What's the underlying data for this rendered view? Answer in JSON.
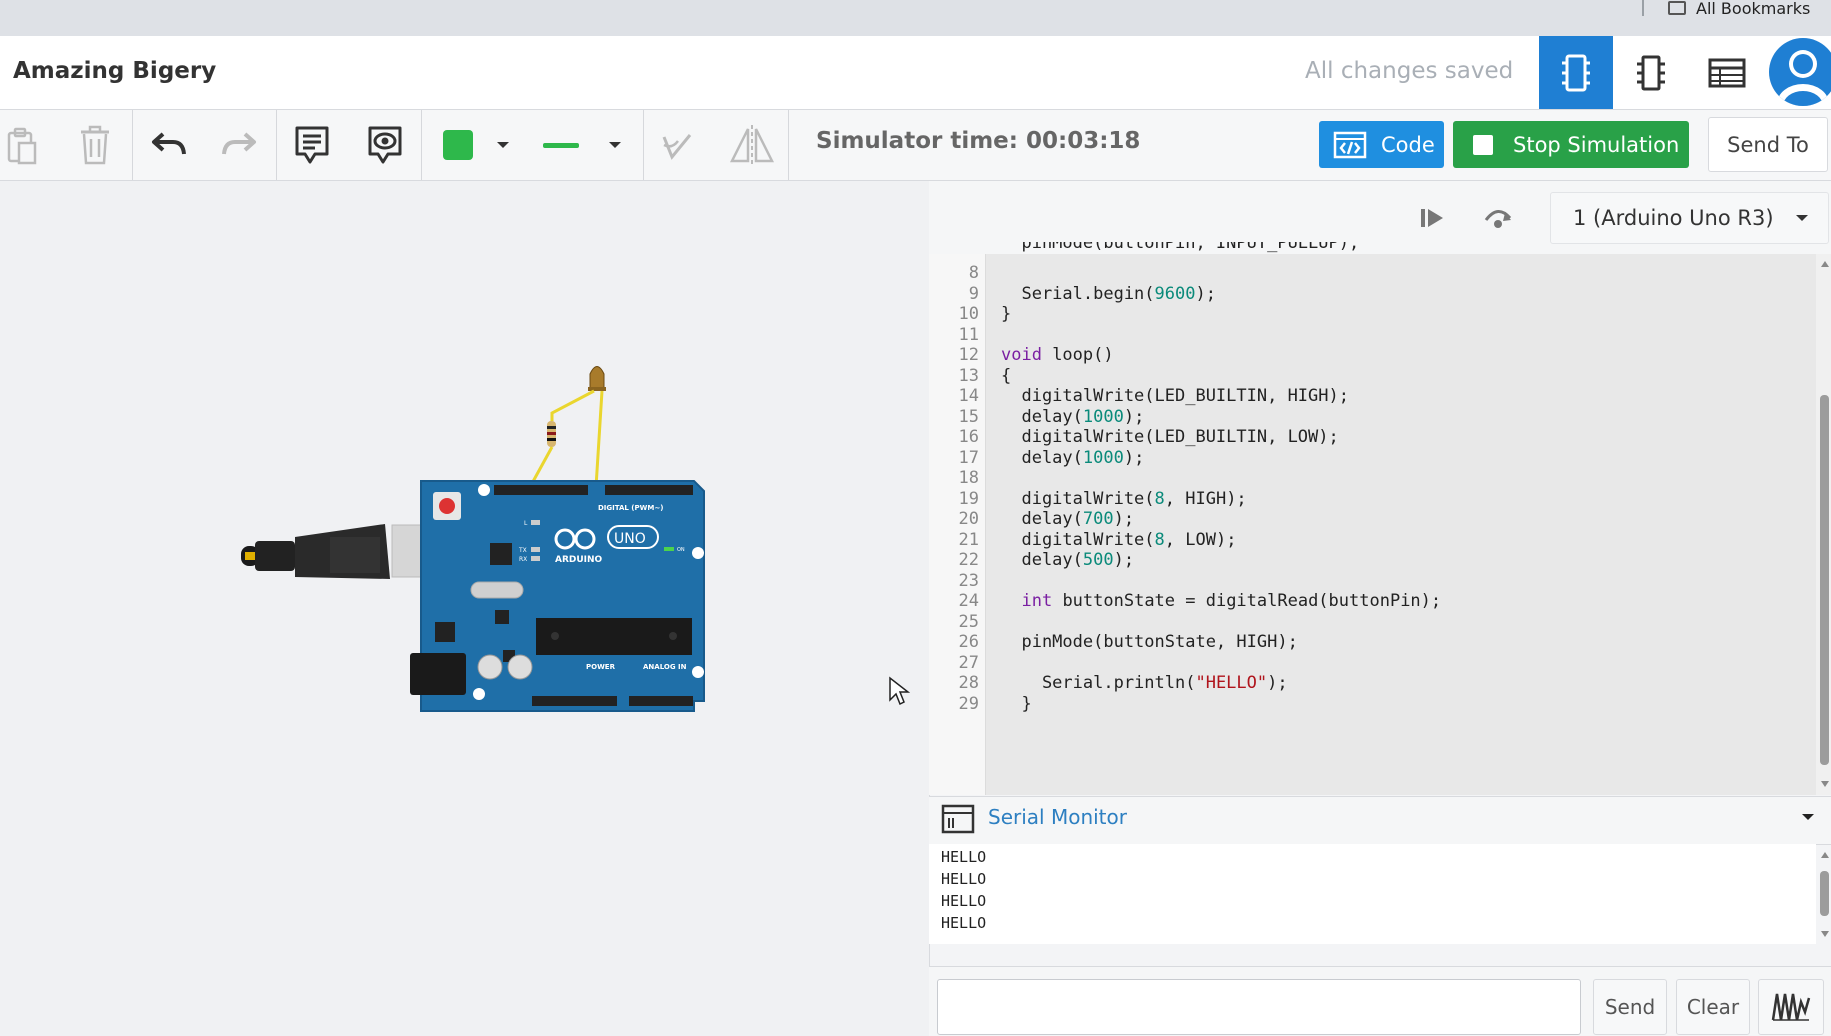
{
  "browser": {
    "bookmarks_label": "All Bookmarks"
  },
  "header": {
    "project_title": "Amazing Bigery",
    "save_status": "All changes saved"
  },
  "toolbar": {
    "simulator_time": "Simulator time: 00:03:18",
    "code_label": "Code",
    "stop_label": "Stop Simulation",
    "send_to_label": "Send To",
    "fill_color": "#2eb84b"
  },
  "code_panel": {
    "device": "1 (Arduino Uno R3)",
    "lines": [
      {
        "n": "8",
        "html": ""
      },
      {
        "n": "9",
        "html": "  Serial.begin(<span class=\"num\">9600</span>);"
      },
      {
        "n": "10",
        "html": "}"
      },
      {
        "n": "11",
        "html": ""
      },
      {
        "n": "12",
        "html": "<span class=\"kw\">void</span> loop()"
      },
      {
        "n": "13",
        "html": "{"
      },
      {
        "n": "14",
        "html": "  digitalWrite(LED_BUILTIN, HIGH);"
      },
      {
        "n": "15",
        "html": "  delay(<span class=\"num\">1000</span>);"
      },
      {
        "n": "16",
        "html": "  digitalWrite(LED_BUILTIN, LOW);"
      },
      {
        "n": "17",
        "html": "  delay(<span class=\"num\">1000</span>);"
      },
      {
        "n": "18",
        "html": ""
      },
      {
        "n": "19",
        "html": "  digitalWrite(<span class=\"num\">8</span>, HIGH);"
      },
      {
        "n": "20",
        "html": "  delay(<span class=\"num\">700</span>);"
      },
      {
        "n": "21",
        "html": "  digitalWrite(<span class=\"num\">8</span>, LOW);"
      },
      {
        "n": "22",
        "html": "  delay(<span class=\"num\">500</span>);"
      },
      {
        "n": "23",
        "html": ""
      },
      {
        "n": "24",
        "html": "  <span class=\"kw\">int</span> buttonState = digitalRead(buttonPin);"
      },
      {
        "n": "25",
        "html": ""
      },
      {
        "n": "26",
        "html": "  pinMode(buttonState, HIGH);"
      },
      {
        "n": "27",
        "html": ""
      },
      {
        "n": "28",
        "html": "    Serial.println(<span class=\"str\">\"HELLO\"</span>);"
      },
      {
        "n": "29",
        "html": "  }"
      }
    ]
  },
  "serial_monitor": {
    "title": "Serial Monitor",
    "output": [
      "HELLO",
      "HELLO",
      "HELLO",
      "HELLO"
    ],
    "input_value": "",
    "send_label": "Send",
    "clear_label": "Clear"
  },
  "board": {
    "labels": [
      "ARDUINO",
      "UNO",
      "DIGITAL (PWM~)",
      "POWER",
      "ANALOG IN",
      "ON",
      "L",
      "TX",
      "RX"
    ]
  }
}
